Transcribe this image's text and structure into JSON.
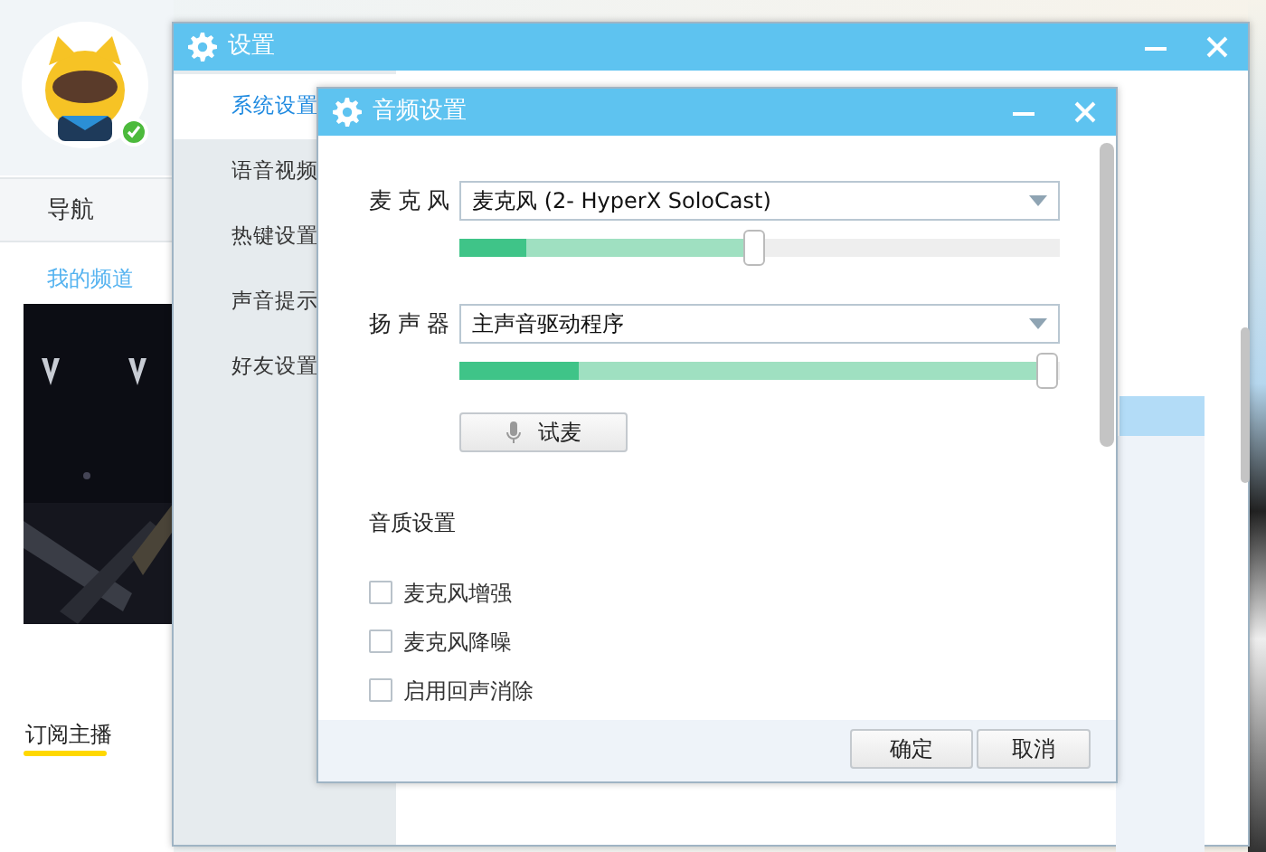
{
  "main_app": {
    "nav_label": "导航",
    "channel_tab": "我的频道",
    "subscribe_tab": "订阅主播",
    "online": true
  },
  "settings_window": {
    "title": "设置",
    "sidebar": [
      {
        "label": "系统设置",
        "selected": true
      },
      {
        "label": "语音视频",
        "selected": false
      },
      {
        "label": "热键设置",
        "selected": false
      },
      {
        "label": "声音提示",
        "selected": false
      },
      {
        "label": "好友设置",
        "selected": false
      }
    ]
  },
  "audio_dialog": {
    "title": "音频设置",
    "devices": [
      {
        "label": "麦克风",
        "value": "麦克风 (2- HyperX SoloCast)",
        "slider": {
          "level": 0.49,
          "meter": {
            "level": 0.11
          }
        }
      },
      {
        "label": "扬声器",
        "value": "主声音驱动程序",
        "slider": {
          "level": 0.98,
          "meter": {
            "level": 0.2
          }
        }
      }
    ],
    "test_button": "试麦",
    "quality_heading": "音质设置",
    "options": [
      {
        "label": "麦克风增强",
        "checked": false
      },
      {
        "label": "麦克风降噪",
        "checked": false
      },
      {
        "label": "启用回声消除",
        "checked": false
      }
    ],
    "buttons": [
      "确定",
      "取消"
    ]
  }
}
